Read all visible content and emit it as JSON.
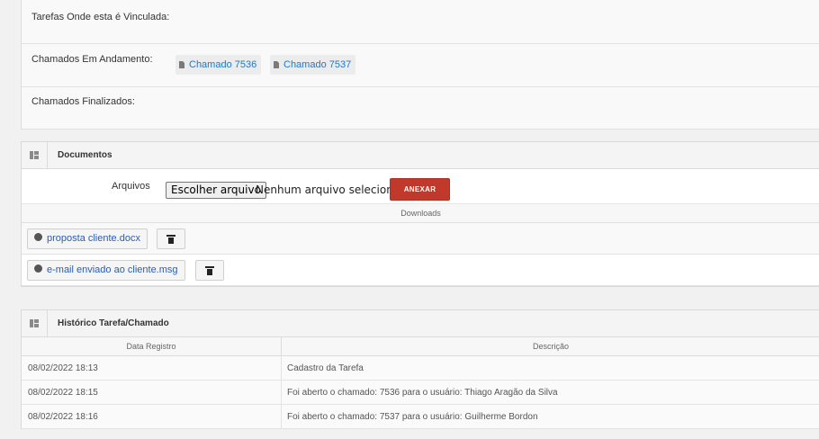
{
  "info": {
    "tarefas_label": "Tarefas Onde esta é Vinculada:",
    "andamento_label": "Chamados Em Andamento:",
    "andamento_chips": [
      "Chamado 7536",
      "Chamado 7537"
    ],
    "finalizados_label": "Chamados Finalizados:"
  },
  "documentos": {
    "title": "Documentos",
    "arquivos_label": "Arquivos",
    "choose_button": "Escolher arquivo",
    "no_file_text": "Nenhum arquivo selecionado",
    "anexar_button": "ANEXAR",
    "downloads_label": "Downloads",
    "files": [
      "proposta cliente.docx",
      "e-mail enviado ao cliente.msg"
    ]
  },
  "historico": {
    "title": "Histórico Tarefa/Chamado",
    "col_date": "Data Registro",
    "col_desc": "Descrição",
    "rows": [
      {
        "date": "08/02/2022 18:13",
        "desc": "Cadastro da Tarefa"
      },
      {
        "date": "08/02/2022 18:15",
        "desc": "Foi aberto o chamado: 7536 para o usuário: Thiago Aragão da Silva"
      },
      {
        "date": "08/02/2022 18:16",
        "desc": "Foi aberto o chamado: 7537 para o usuário: Guilherme Bordon"
      }
    ]
  },
  "colors": {
    "accent_link": "#1f78c8",
    "anexar_bg": "#c0392b",
    "file_link": "#2a5db0"
  }
}
